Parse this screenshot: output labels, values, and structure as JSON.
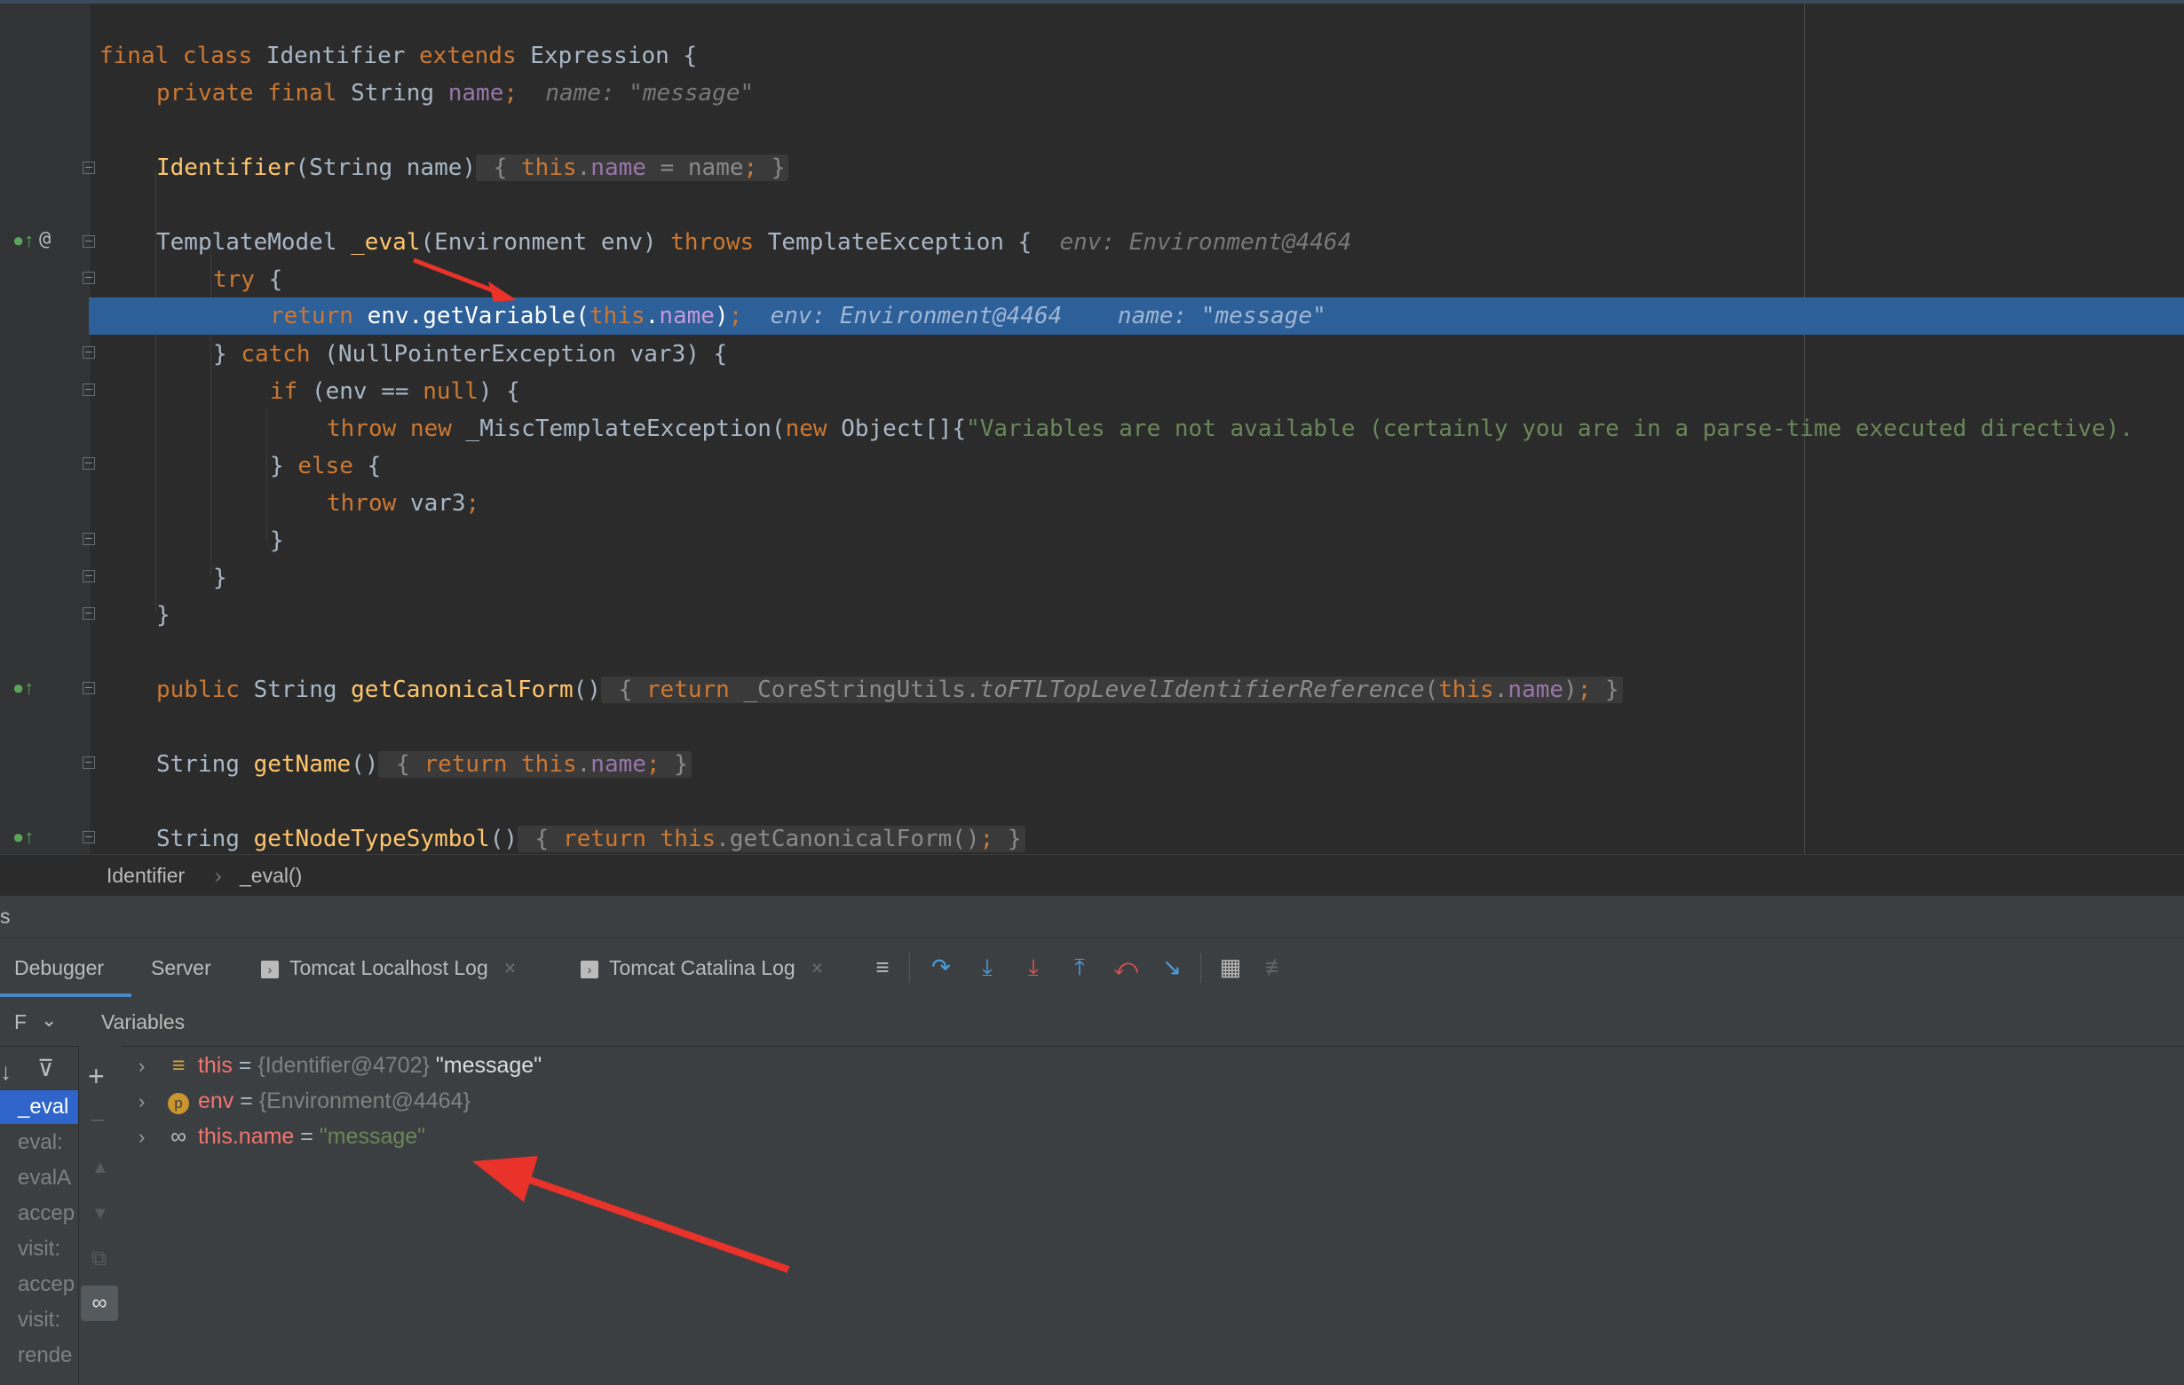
{
  "editor": {
    "code_lines": {
      "l1": {
        "kw1": "final class ",
        "name": "Identifier ",
        "kw2": "extends ",
        "rest": "Expression {"
      },
      "l2": {
        "kw": "private final ",
        "type": "String ",
        "field": "name",
        "semi": ";",
        "hint": "name: \"message\""
      },
      "l3": {
        "fn": "Identifier",
        "sig": "(String name)",
        "open": " { ",
        "this": "this",
        "dot": ".",
        "field": "name",
        "assign": " = name",
        "semi": ";",
        "close": " }"
      },
      "l4": {
        "type": "TemplateModel ",
        "fn": "_eval",
        "sig": "(Environment env) ",
        "kw": "throws ",
        "exc": "TemplateException {",
        "hint": "env: Environment@4464"
      },
      "l5": {
        "kw": "try",
        "rest": " {"
      },
      "l6": {
        "kw": "return ",
        "call": "env.getVariable(",
        "this": "this",
        "dot": ".",
        "field": "name",
        "end": ")",
        "semi": ";",
        "hint1": "env: Environment@4464",
        "hint2": "name: \"message\""
      },
      "l7": {
        "pre": "} ",
        "kw": "catch",
        "rest": " (NullPointerException var3) {"
      },
      "l8": {
        "kw": "if",
        "mid": " (env == ",
        "kw2": "null",
        "rest": ") {"
      },
      "l9": {
        "kw": "throw new ",
        "call": "_MiscTemplateException(",
        "kw2": "new ",
        "arr": "Object[]{",
        "str": "\"Variables are not available (certainly you are in a parse-time executed directive)."
      },
      "l10": {
        "pre": "} ",
        "kw": "else",
        "rest": " {"
      },
      "l11": {
        "kw": "throw ",
        "rest": "var3",
        "semi": ";"
      },
      "l12": {
        "text": "}"
      },
      "l13": {
        "text": "}"
      },
      "l14": {
        "text": "}"
      },
      "l15": {
        "kw": "public ",
        "type": "String ",
        "fn": "getCanonicalForm",
        "sig": "()",
        "open": " { ",
        "kw2": "return ",
        "cls": "_CoreStringUtils.",
        "static": "toFTLTopLevelIdentifierReference",
        "arg": "(",
        "this": "this",
        "dot": ".",
        "field": "name",
        "end": ")",
        "semi": ";",
        "close": " }"
      },
      "l16": {
        "type": "String ",
        "fn": "getName",
        "sig": "()",
        "open": " { ",
        "kw": "return ",
        "this": "this",
        "dot": ".",
        "field": "name",
        "semi": ";",
        "close": " }"
      },
      "l17": {
        "type": "String ",
        "fn": "getNodeTypeSymbol",
        "sig": "()",
        "open": " { ",
        "kw": "return ",
        "this": "this",
        "rest": ".getCanonicalForm()",
        "semi": ";",
        "close": " }"
      }
    },
    "gutter_at": "@"
  },
  "breadcrumb": {
    "class_name": "Identifier",
    "separator": "›",
    "method": "_eval()"
  },
  "tool_window": {
    "header_label": "s",
    "tabs": [
      {
        "label": "Debugger"
      },
      {
        "label": "Server"
      },
      {
        "label": "Tomcat Localhost Log",
        "close": "×"
      },
      {
        "label": "Tomcat Catalina Log",
        "close": "×"
      }
    ],
    "frames": {
      "header_label": "F",
      "items": [
        "_eval",
        "eval:",
        "evalA",
        "accep",
        "visit:",
        "accep",
        "visit:",
        "rende"
      ]
    },
    "variables": {
      "header_label": "Variables",
      "rows": [
        {
          "name": "this",
          "eq": " = ",
          "type": "{Identifier@4702} ",
          "value": "\"message\""
        },
        {
          "name": "env",
          "eq": " = ",
          "type": "{Environment@4464}",
          "value": ""
        },
        {
          "name": "this.name",
          "eq": " = ",
          "type": "",
          "value": "\"message\""
        }
      ]
    }
  },
  "colors": {
    "editor_bg": "#2b2b2b",
    "keyword": "#cc7832",
    "function": "#ffc66d",
    "field": "#9876aa",
    "string": "#6a8759",
    "selection": "#2d5f99",
    "annotation_arrow": "#e8322a"
  }
}
